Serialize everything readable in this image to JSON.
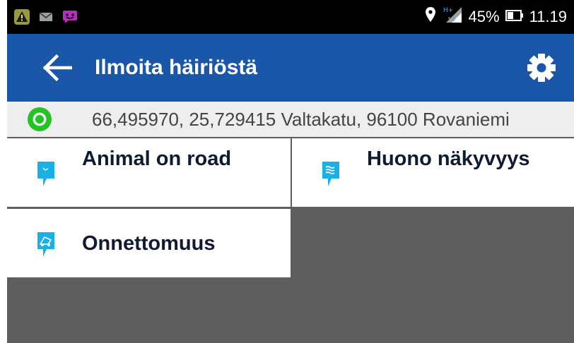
{
  "status_bar": {
    "notifications": [
      "warning-icon",
      "mail-icon",
      "chat-icon"
    ],
    "battery_percent": "45%",
    "time": "11.19",
    "network": "H+"
  },
  "app_bar": {
    "title": "Ilmoita häiriöstä",
    "color": "#1a57a8"
  },
  "location": {
    "text": "66,495970, 25,729415  Valtakatu, 96100 Rovaniemi",
    "status_color": "#22c322"
  },
  "tiles": [
    {
      "label": "Animal on road",
      "icon": "animal-report-icon"
    },
    {
      "label": "Huono näkyvyys",
      "icon": "fog-report-icon"
    },
    {
      "label": "Onnettomuus",
      "icon": "accident-report-icon"
    }
  ]
}
